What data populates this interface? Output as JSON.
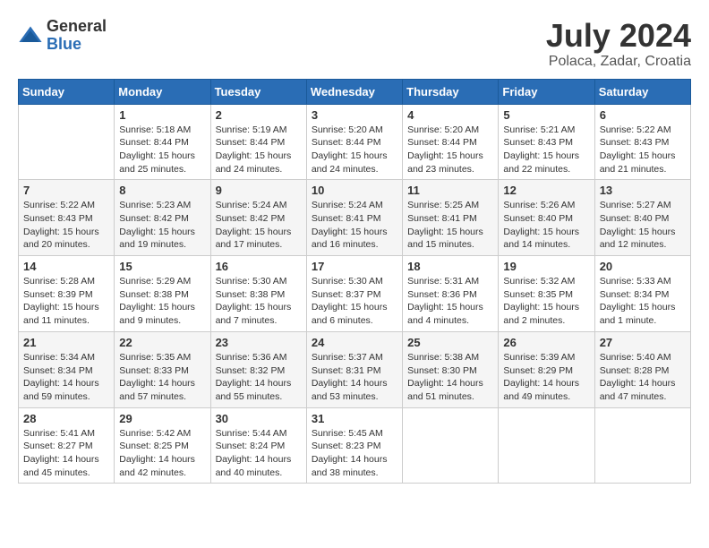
{
  "header": {
    "logo_general": "General",
    "logo_blue": "Blue",
    "month_year": "July 2024",
    "location": "Polaca, Zadar, Croatia"
  },
  "calendar": {
    "days_of_week": [
      "Sunday",
      "Monday",
      "Tuesday",
      "Wednesday",
      "Thursday",
      "Friday",
      "Saturday"
    ],
    "weeks": [
      [
        {
          "day": "",
          "info": ""
        },
        {
          "day": "1",
          "info": "Sunrise: 5:18 AM\nSunset: 8:44 PM\nDaylight: 15 hours\nand 25 minutes."
        },
        {
          "day": "2",
          "info": "Sunrise: 5:19 AM\nSunset: 8:44 PM\nDaylight: 15 hours\nand 24 minutes."
        },
        {
          "day": "3",
          "info": "Sunrise: 5:20 AM\nSunset: 8:44 PM\nDaylight: 15 hours\nand 24 minutes."
        },
        {
          "day": "4",
          "info": "Sunrise: 5:20 AM\nSunset: 8:44 PM\nDaylight: 15 hours\nand 23 minutes."
        },
        {
          "day": "5",
          "info": "Sunrise: 5:21 AM\nSunset: 8:43 PM\nDaylight: 15 hours\nand 22 minutes."
        },
        {
          "day": "6",
          "info": "Sunrise: 5:22 AM\nSunset: 8:43 PM\nDaylight: 15 hours\nand 21 minutes."
        }
      ],
      [
        {
          "day": "7",
          "info": "Sunrise: 5:22 AM\nSunset: 8:43 PM\nDaylight: 15 hours\nand 20 minutes."
        },
        {
          "day": "8",
          "info": "Sunrise: 5:23 AM\nSunset: 8:42 PM\nDaylight: 15 hours\nand 19 minutes."
        },
        {
          "day": "9",
          "info": "Sunrise: 5:24 AM\nSunset: 8:42 PM\nDaylight: 15 hours\nand 17 minutes."
        },
        {
          "day": "10",
          "info": "Sunrise: 5:24 AM\nSunset: 8:41 PM\nDaylight: 15 hours\nand 16 minutes."
        },
        {
          "day": "11",
          "info": "Sunrise: 5:25 AM\nSunset: 8:41 PM\nDaylight: 15 hours\nand 15 minutes."
        },
        {
          "day": "12",
          "info": "Sunrise: 5:26 AM\nSunset: 8:40 PM\nDaylight: 15 hours\nand 14 minutes."
        },
        {
          "day": "13",
          "info": "Sunrise: 5:27 AM\nSunset: 8:40 PM\nDaylight: 15 hours\nand 12 minutes."
        }
      ],
      [
        {
          "day": "14",
          "info": "Sunrise: 5:28 AM\nSunset: 8:39 PM\nDaylight: 15 hours\nand 11 minutes."
        },
        {
          "day": "15",
          "info": "Sunrise: 5:29 AM\nSunset: 8:38 PM\nDaylight: 15 hours\nand 9 minutes."
        },
        {
          "day": "16",
          "info": "Sunrise: 5:30 AM\nSunset: 8:38 PM\nDaylight: 15 hours\nand 7 minutes."
        },
        {
          "day": "17",
          "info": "Sunrise: 5:30 AM\nSunset: 8:37 PM\nDaylight: 15 hours\nand 6 minutes."
        },
        {
          "day": "18",
          "info": "Sunrise: 5:31 AM\nSunset: 8:36 PM\nDaylight: 15 hours\nand 4 minutes."
        },
        {
          "day": "19",
          "info": "Sunrise: 5:32 AM\nSunset: 8:35 PM\nDaylight: 15 hours\nand 2 minutes."
        },
        {
          "day": "20",
          "info": "Sunrise: 5:33 AM\nSunset: 8:34 PM\nDaylight: 15 hours\nand 1 minute."
        }
      ],
      [
        {
          "day": "21",
          "info": "Sunrise: 5:34 AM\nSunset: 8:34 PM\nDaylight: 14 hours\nand 59 minutes."
        },
        {
          "day": "22",
          "info": "Sunrise: 5:35 AM\nSunset: 8:33 PM\nDaylight: 14 hours\nand 57 minutes."
        },
        {
          "day": "23",
          "info": "Sunrise: 5:36 AM\nSunset: 8:32 PM\nDaylight: 14 hours\nand 55 minutes."
        },
        {
          "day": "24",
          "info": "Sunrise: 5:37 AM\nSunset: 8:31 PM\nDaylight: 14 hours\nand 53 minutes."
        },
        {
          "day": "25",
          "info": "Sunrise: 5:38 AM\nSunset: 8:30 PM\nDaylight: 14 hours\nand 51 minutes."
        },
        {
          "day": "26",
          "info": "Sunrise: 5:39 AM\nSunset: 8:29 PM\nDaylight: 14 hours\nand 49 minutes."
        },
        {
          "day": "27",
          "info": "Sunrise: 5:40 AM\nSunset: 8:28 PM\nDaylight: 14 hours\nand 47 minutes."
        }
      ],
      [
        {
          "day": "28",
          "info": "Sunrise: 5:41 AM\nSunset: 8:27 PM\nDaylight: 14 hours\nand 45 minutes."
        },
        {
          "day": "29",
          "info": "Sunrise: 5:42 AM\nSunset: 8:25 PM\nDaylight: 14 hours\nand 42 minutes."
        },
        {
          "day": "30",
          "info": "Sunrise: 5:44 AM\nSunset: 8:24 PM\nDaylight: 14 hours\nand 40 minutes."
        },
        {
          "day": "31",
          "info": "Sunrise: 5:45 AM\nSunset: 8:23 PM\nDaylight: 14 hours\nand 38 minutes."
        },
        {
          "day": "",
          "info": ""
        },
        {
          "day": "",
          "info": ""
        },
        {
          "day": "",
          "info": ""
        }
      ]
    ]
  }
}
